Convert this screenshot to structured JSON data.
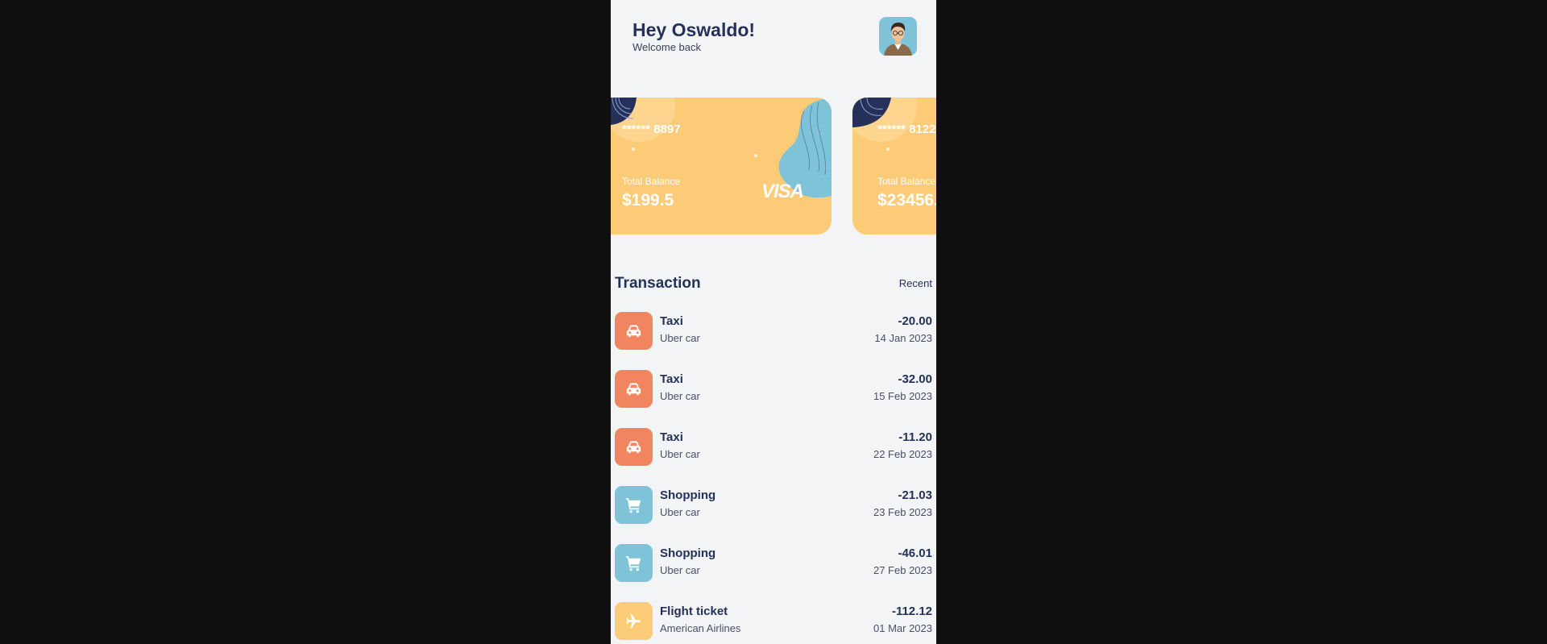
{
  "header": {
    "title": "Hey Oswaldo!",
    "subtitle": "Welcome back"
  },
  "cards": [
    {
      "number": "****** 8897",
      "balance_label": "Total Balance",
      "balance": "$199.5",
      "brand": "VISA"
    },
    {
      "number": "****** 8122",
      "balance_label": "Total Balance",
      "balance": "$23456."
    }
  ],
  "transactions": {
    "title": "Transaction",
    "filter_label": "Recent",
    "items": [
      {
        "icon": "car-icon",
        "color": "#f08560",
        "title": "Taxi",
        "subtitle": "Uber car",
        "amount": "-20.00",
        "date": "14 Jan 2023"
      },
      {
        "icon": "car-icon",
        "color": "#f08560",
        "title": "Taxi",
        "subtitle": "Uber car",
        "amount": "-32.00",
        "date": "15 Feb 2023"
      },
      {
        "icon": "car-icon",
        "color": "#f08560",
        "title": "Taxi",
        "subtitle": "Uber car",
        "amount": "-11.20",
        "date": "22 Feb 2023"
      },
      {
        "icon": "cart-icon",
        "color": "#7ec3d7",
        "title": "Shopping",
        "subtitle": "Uber car",
        "amount": "-21.03",
        "date": "23 Feb 2023"
      },
      {
        "icon": "cart-icon",
        "color": "#7ec3d7",
        "title": "Shopping",
        "subtitle": "Uber car",
        "amount": "-46.01",
        "date": "27 Feb 2023"
      },
      {
        "icon": "plane-icon",
        "color": "#fbcb78",
        "title": "Flight ticket",
        "subtitle": "American Airlines",
        "amount": "-112.12",
        "date": "01 Mar 2023"
      }
    ]
  }
}
